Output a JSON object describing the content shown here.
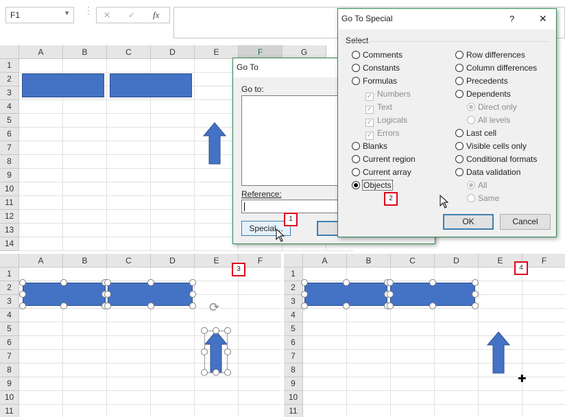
{
  "formula_bar": {
    "name_box": "F1",
    "cancel_symbol": "✕",
    "enter_symbol": "✓",
    "fx_label": "fx"
  },
  "top_grid": {
    "columns": [
      "A",
      "B",
      "C",
      "D",
      "E",
      "F",
      "G"
    ],
    "selected_column": "F",
    "rows": [
      "1",
      "2",
      "3",
      "4",
      "5",
      "6",
      "7",
      "8",
      "9",
      "10",
      "11",
      "12",
      "13",
      "14"
    ]
  },
  "goto_dialog": {
    "title": "Go To",
    "goto_label": "Go to:",
    "reference_label": "Reference:",
    "special_button": "Special..."
  },
  "goto_special": {
    "title": "Go To Special",
    "help": "?",
    "close": "✕",
    "group_label": "Select",
    "left_options": {
      "comments": "Comments",
      "constants": "Constants",
      "formulas": "Formulas",
      "numbers": "Numbers",
      "text": "Text",
      "logicals": "Logicals",
      "errors": "Errors",
      "blanks": "Blanks",
      "current_region": "Current region",
      "current_array": "Current array",
      "objects": "Objects"
    },
    "right_options": {
      "row_differences": "Row differences",
      "column_differences": "Column differences",
      "precedents": "Precedents",
      "dependents": "Dependents",
      "direct_only": "Direct only",
      "all_levels": "All levels",
      "last_cell": "Last cell",
      "visible_cells_only": "Visible cells only",
      "conditional_formats": "Conditional formats",
      "data_validation": "Data validation",
      "all": "All",
      "same": "Same"
    },
    "selected_option": "Objects",
    "ok": "OK",
    "cancel": "Cancel"
  },
  "bottom_left_grid": {
    "columns": [
      "A",
      "B",
      "C",
      "D",
      "E",
      "F"
    ],
    "rows": [
      "1",
      "2",
      "3",
      "4",
      "5",
      "6",
      "7",
      "8",
      "9",
      "10",
      "11"
    ]
  },
  "bottom_right_grid": {
    "columns": [
      "A",
      "B",
      "C",
      "D",
      "E",
      "F"
    ],
    "rows": [
      "1",
      "2",
      "3",
      "4",
      "5",
      "6",
      "7",
      "8",
      "9",
      "10",
      "11"
    ]
  },
  "callouts": {
    "step1": "1",
    "step2": "2",
    "step3": "3",
    "step4": "4"
  },
  "colors": {
    "shape_fill": "#4472c4",
    "shape_border": "#2f528f",
    "dialog_border": "#2e8b57",
    "callout_border": "#e0001b",
    "selected_header": "#217346"
  }
}
